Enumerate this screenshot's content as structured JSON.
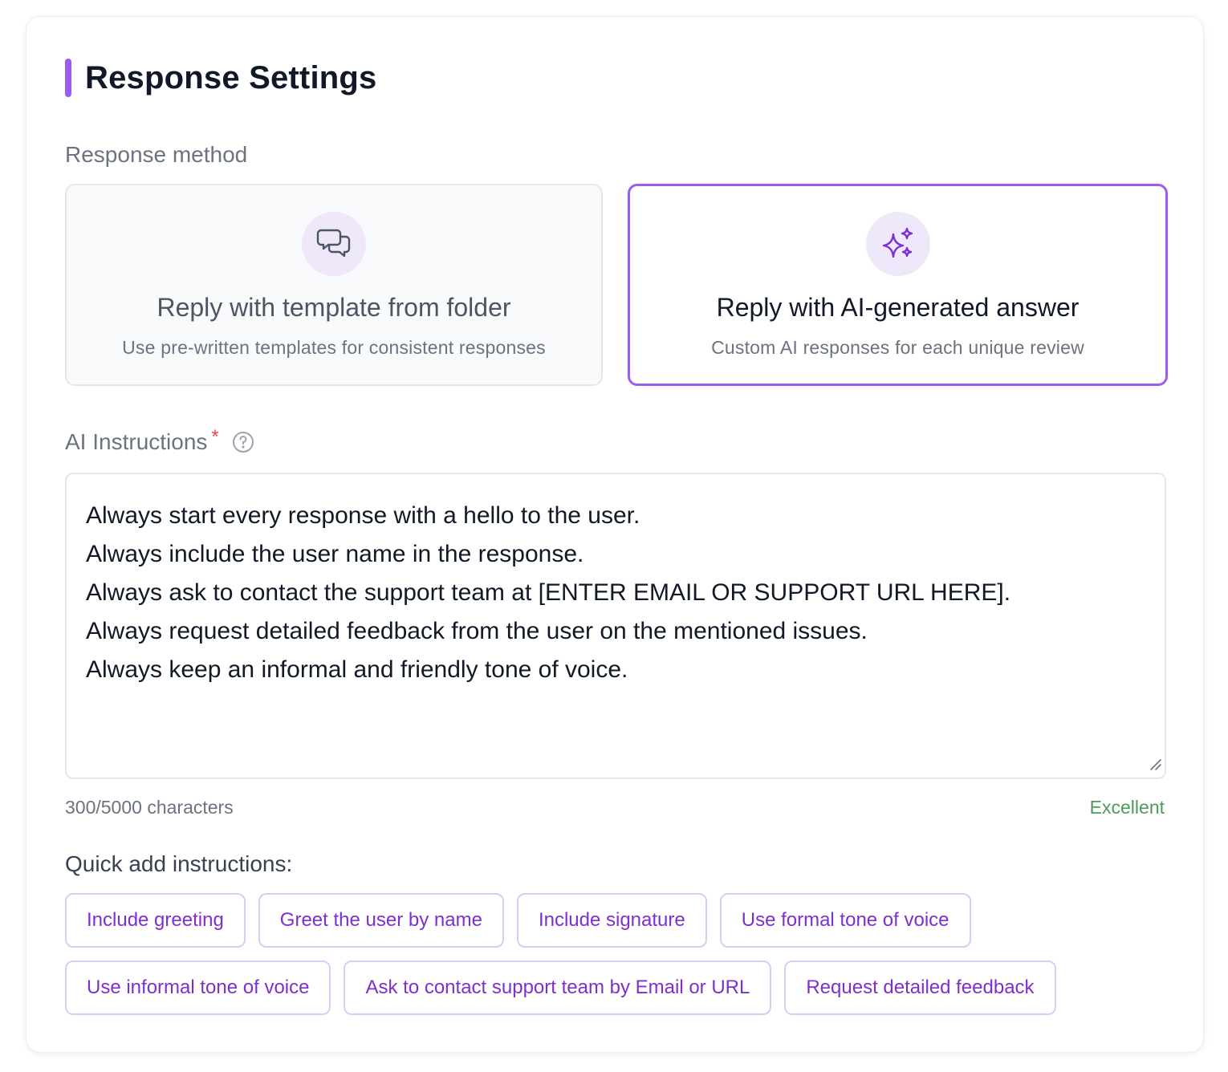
{
  "page": {
    "title": "Response Settings"
  },
  "colors": {
    "accent": "#9b5cf0",
    "chip_text": "#7e2fd0",
    "quality_good": "#4f9a59",
    "required": "#ef4444"
  },
  "response_method": {
    "label": "Response method",
    "options": [
      {
        "icon": "chat-bubbles-icon",
        "title": "Reply with template from folder",
        "description": "Use pre-written templates for consistent responses",
        "selected": false
      },
      {
        "icon": "sparkles-icon",
        "title": "Reply with AI-generated answer",
        "description": "Custom AI responses for each unique review",
        "selected": true
      }
    ]
  },
  "ai_instructions": {
    "label": "AI Instructions",
    "required_mark": "*",
    "help_icon": "question-circle-icon",
    "lines": [
      "Always start every response with a hello to the user.",
      "Always include the user name in the response.",
      "Always ask to contact the support team at [ENTER EMAIL OR SUPPORT URL HERE].",
      "Always request detailed feedback from the user on the mentioned issues.",
      "Always keep an informal and friendly tone of voice."
    ],
    "char_count": "300/5000 characters",
    "quality": "Excellent"
  },
  "quick_add": {
    "label": "Quick add instructions:",
    "chips": [
      "Include greeting",
      "Greet the user by name",
      "Include signature",
      "Use formal tone of voice",
      "Use informal tone of voice",
      "Ask to contact support team by Email or URL",
      "Request detailed feedback"
    ]
  }
}
